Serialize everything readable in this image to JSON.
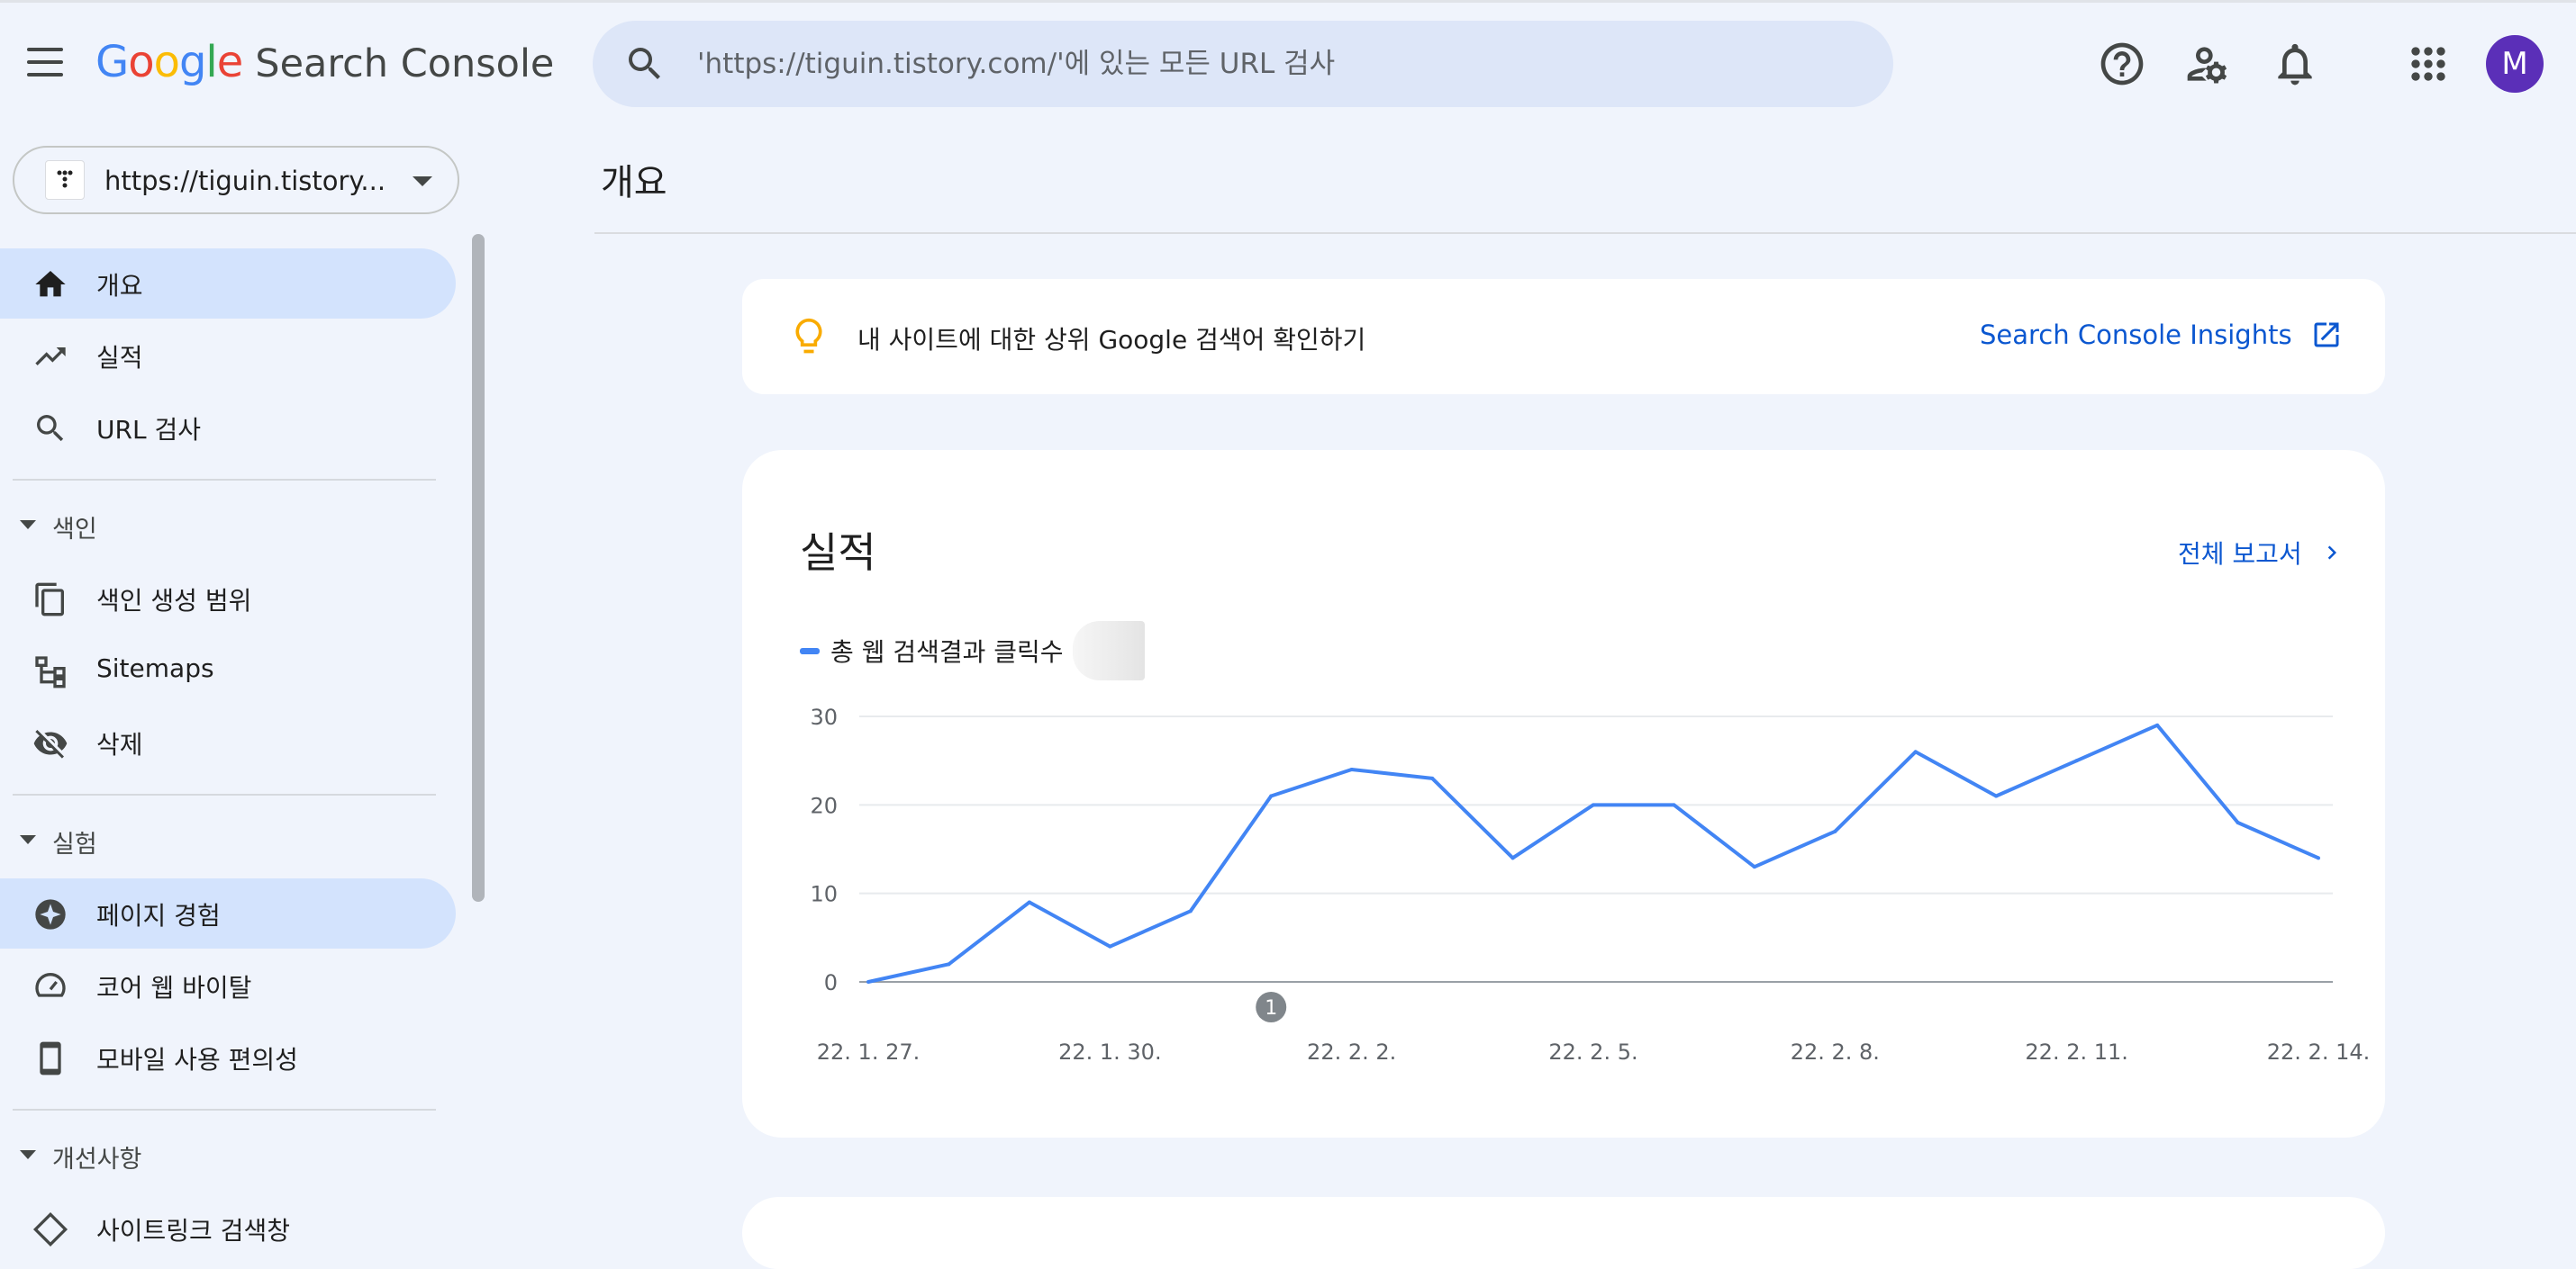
{
  "header": {
    "logo_google": [
      "G",
      "o",
      "o",
      "g",
      "l",
      "e"
    ],
    "logo_colors": [
      "#4285f4",
      "#ea4335",
      "#fbbc05",
      "#4285f4",
      "#34a853",
      "#ea4335"
    ],
    "product": "Search Console",
    "search_placeholder": "'https://tiguin.tistory.com/'에 있는 모든 URL 검사",
    "avatar_letter": "M",
    "avatar_color": "#5b2fb8"
  },
  "property": {
    "label": "https://tiguin.tistory..."
  },
  "sidebar": {
    "items": [
      {
        "label": "개요",
        "icon": "home-icon",
        "active": true
      },
      {
        "label": "실적",
        "icon": "trending-up-icon"
      },
      {
        "label": "URL 검사",
        "icon": "search-icon"
      }
    ],
    "index_section": "색인",
    "index_items": [
      {
        "label": "색인 생성 범위",
        "icon": "copy-pages-icon"
      },
      {
        "label": "Sitemaps",
        "icon": "sitemap-icon"
      },
      {
        "label": "삭제",
        "icon": "eye-off-icon"
      }
    ],
    "experience_section": "실험",
    "experience_items": [
      {
        "label": "페이지 경험",
        "icon": "page-experience-icon",
        "active": true
      },
      {
        "label": "코어 웹 바이탈",
        "icon": "speedometer-icon"
      },
      {
        "label": "모바일 사용 편의성",
        "icon": "mobile-icon"
      }
    ],
    "enhancements_section": "개선사항",
    "enhancements_items": [
      {
        "label": "사이트링크 검색창",
        "icon": "diamond-icon"
      }
    ]
  },
  "main": {
    "title": "개요",
    "insights": {
      "text": "내 사이트에 대한 상위 Google 검색어 확인하기",
      "link": "Search Console Insights"
    },
    "performance": {
      "title": "실적",
      "full_report": "전체 보고서",
      "legend": "총 웹 검색결과 클릭수"
    }
  },
  "chart_data": {
    "type": "line",
    "series": [
      {
        "name": "총 웹 검색결과 클릭수",
        "color": "#4285f4",
        "values": [
          0,
          2,
          9,
          4,
          8,
          21,
          24,
          23,
          14,
          20,
          20,
          13,
          17,
          26,
          21,
          25,
          29,
          18,
          14
        ]
      }
    ],
    "x": [
      "22. 1. 27.",
      "22. 1. 28.",
      "22. 1. 29.",
      "22. 1. 30.",
      "22. 1. 31.",
      "22. 2. 1.",
      "22. 2. 2.",
      "22. 2. 3.",
      "22. 2. 4.",
      "22. 2. 5.",
      "22. 2. 6.",
      "22. 2. 7.",
      "22. 2. 8.",
      "22. 2. 9.",
      "22. 2. 10.",
      "22. 2. 11.",
      "22. 2. 12.",
      "22. 2. 13.",
      "22. 2. 14."
    ],
    "x_tick_labels": [
      "22. 1. 27.",
      "22. 1. 30.",
      "22. 2. 2.",
      "22. 2. 5.",
      "22. 2. 8.",
      "22. 2. 11.",
      "22. 2. 14."
    ],
    "y_ticks": [
      0,
      10,
      20,
      30
    ],
    "ylim": [
      0,
      30
    ],
    "grid": true,
    "annotation": {
      "label": "1",
      "x": "22. 2. 1."
    }
  }
}
